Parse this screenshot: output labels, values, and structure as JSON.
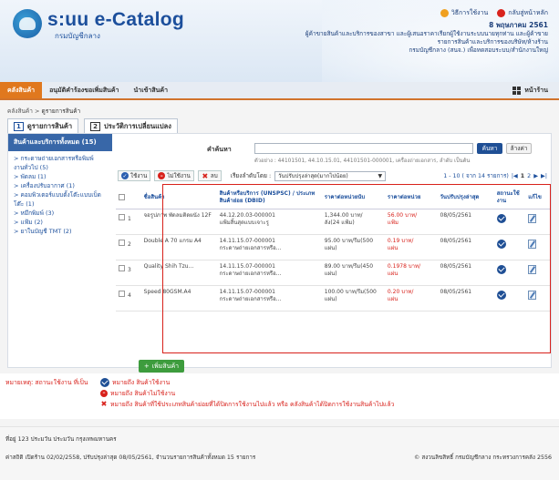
{
  "header": {
    "logo_title": "s:uu e-Catalog",
    "logo_sub": "กรมบัญชีกลาง",
    "link_manual": "วิธีการใช้งาน",
    "link_home": "กลับสู่หน้าหลัก",
    "date": "8 พฤษภาคม 2561",
    "org_line1": "ผู้ค้าขายสินค้าและบริการของสาขา และผู้เสนอราคาเรียกผู้ใช้งานระบบนายทุกท่าน และผู้ค้าขาย",
    "org_line2": "รายการสินค้าและบริการของบริษัท/ห้างร้าน",
    "org_line3": "กรมบัญชีกลาง (สนจ.) เพื่อทดสอบระบบ/สำนักงานใหญ่"
  },
  "nav": {
    "items": [
      "คลังสินค้า",
      "อนุมัติคำร้องขอเพิ่มสินค้า",
      "นำเข้าสินค้า"
    ],
    "home": "หน้าร้าน"
  },
  "breadcrumb": {
    "root": "คลังสินค้า",
    "sep": ">",
    "current": "ดูรายการสินค้า"
  },
  "tabs": [
    {
      "num": "1",
      "label": "ดูรายการสินค้า"
    },
    {
      "num": "2",
      "label": "ประวัติการเปลี่ยนแปลง"
    }
  ],
  "sidebar": {
    "header": "สินค้าและบริการทั้งหมด (15)",
    "items": [
      "> กระดาษถ่ายเอกสารหรือพิมพ์",
      "งานทั่วไป (5)",
      "> พัดลม (1)",
      "> เครื่องปรับอากาศ (1)",
      "> คอมพิวเตอร์แบบตั้งโต๊ะแบบเบ็ด",
      "โต๊ะ (1)",
      "> หมึกพิมพ์ (3)",
      "> แฟ้ม (2)",
      "> ยาในบัญชี TMT (2)"
    ]
  },
  "search": {
    "label": "คำค้นหา",
    "button": "ค้นหา",
    "clear": "ล้างค่า",
    "example": "ตัวอย่าง : 44101501, 44.10.15.01, 44101501-000001, เครื่องถ่ายเอกสาร, ลำดับ เป็นต้น"
  },
  "toolbar": {
    "enable": "ใช้งาน",
    "disable": "ไม่ใช้งาน",
    "delete": "ลบ",
    "sort_label": "เรียงลำดับโดย :",
    "sort_value": "วันปรับปรุงล่าสุด(มากไปน้อย)",
    "pager_text": "1 - 10 ( จาก 14 รายการ)",
    "pages": [
      "1",
      "2"
    ]
  },
  "table": {
    "headers": [
      "",
      "ชื่อสินค้า",
      "สินค้าหรือบริการ (UNSPSC) / ประเภทสินค้าย่อย (DBID)",
      "ราคาต่อหน่วยนับ",
      "ราคาต่อหน่วย",
      "วันปรับปรุงล่าสุด",
      "สถานะใช้งาน",
      "แก้ไข"
    ],
    "rows": [
      {
        "num": "1",
        "name": "จอรูปภาพ พัดลมติดผนัง 12F",
        "code1": "44.12.20.03-000001",
        "code2": "แฟ้มสิ้นสุดแบบเจาะรู",
        "price1": "1,344.00 บาท/",
        "price1b": "ลัง(24 แฟ้ม)",
        "price2": "56.00 บาท/",
        "price2b": "แฟ้ม",
        "date": "08/05/2561"
      },
      {
        "num": "2",
        "name": "Double A 70 แกรม A4",
        "code1": "14.11.15.07-000001",
        "code2": "กระดาษถ่ายเอกสารหรือ...",
        "price1": "95.00 บาท/รีม(500",
        "price1b": "แผ่น)",
        "price2": "0.19 บาท/",
        "price2b": "แผ่น",
        "date": "08/05/2561"
      },
      {
        "num": "3",
        "name": "Quality Shih Tzu...",
        "code1": "14.11.15.07-000001",
        "code2": "กระดาษถ่ายเอกสารหรือ...",
        "price1": "89.00 บาท/รีม(450",
        "price1b": "แผ่น)",
        "price2": "0.1978 บาท/",
        "price2b": "แผ่น",
        "date": "08/05/2561"
      },
      {
        "num": "4",
        "name": "Speed 80GSM.A4",
        "code1": "14.11.15.07-000001",
        "code2": "กระดาษถ่ายเอกสารหรือ...",
        "price1": "100.00 บาท/รีม(500",
        "price1b": "แผ่น)",
        "price2": "0.20 บาท/",
        "price2b": "แผ่น",
        "date": "08/05/2561"
      }
    ]
  },
  "add_button": "เพิ่มสินค้า",
  "notes": {
    "title": "หมายเหตุ: สถานะใช้งาน ที่เป็น",
    "line1": "หมายถึง สินค้าใช้งาน",
    "line2": "หมายถึง สินค้าไม่ใช้งาน",
    "line3": "หมายถึง สินค้าที่ใช้ประเภทสินค้าย่อยที่ได้ปิดการใช้งานไปแล้ว หรือ คลังสินค้าได้ปิดการใช้งานสินค้าไปแล้ว"
  },
  "footer": {
    "address": "ที่อยู่ 123 ประมวัน ประมวัน กรุงเทพมหานคร",
    "info": "ค่าสถิติ เปิดร้าน 02/02/2558, ปรับปรุงล่าสุด 08/05/2561, จำนวนรายการสินค้าทั้งหมด 15 รายการ",
    "copyright": "© สงวนลิขสิทธิ์ กรมบัญชีกลาง กระทรวงการคลัง 2556"
  },
  "colors": {
    "brand_blue": "#1c4f9c",
    "accent_orange": "#e0781e",
    "alert_red": "#d8211b",
    "add_green": "#3d9c3d"
  }
}
